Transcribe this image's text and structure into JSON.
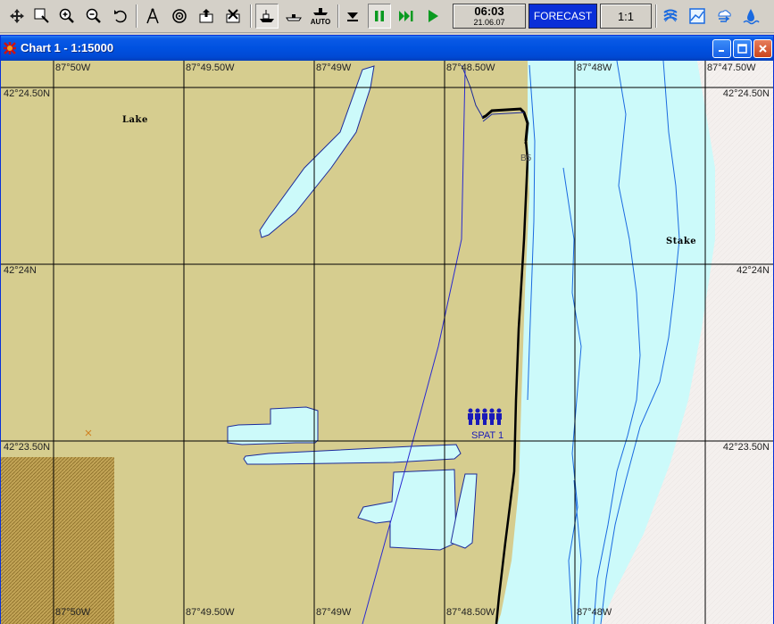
{
  "toolbar": {
    "tools": [
      "pan",
      "zoom-window",
      "zoom-in",
      "zoom-out",
      "undo",
      "measure",
      "target",
      "export",
      "delete-route",
      "own-ship",
      "ship-profile",
      "auto"
    ],
    "auto_label": "AUTO",
    "playback": [
      "stop",
      "pause",
      "fast-forward",
      "play"
    ],
    "clock_time": "06:03",
    "clock_date": "21.06.07",
    "forecast_label": "FORECAST",
    "scale_label": "1:1",
    "right_tools": [
      "currents",
      "chart-layers",
      "weather",
      "tide"
    ]
  },
  "window": {
    "title": "Chart 1 - 1:15000"
  },
  "chart": {
    "top_lon_labels": [
      "87°50W",
      "87°49.50W",
      "87°49W",
      "87°48.50W",
      "87°48W",
      "87°47.50W"
    ],
    "bottom_lon_labels": [
      "87°50W",
      "87°49.50W",
      "87°49W",
      "87°48.50W",
      "87°48W"
    ],
    "left_lat_labels": [
      "42°24.50N",
      "42°24N",
      "42°23.50N"
    ],
    "right_lat_labels": [
      "42°24.50N",
      "42°24N",
      "42°23.50N"
    ],
    "places": [
      "Lake",
      "Stake"
    ],
    "buoy_label": "B5",
    "target_label": "SPAT 1",
    "colors": {
      "land": "#d6cd8f",
      "shallow_water": "#ccfafa",
      "deep_water": "#f5f2f0",
      "grid": "#000000",
      "route": "#2a2ad0",
      "hatched_area": "#b89a4a"
    }
  }
}
